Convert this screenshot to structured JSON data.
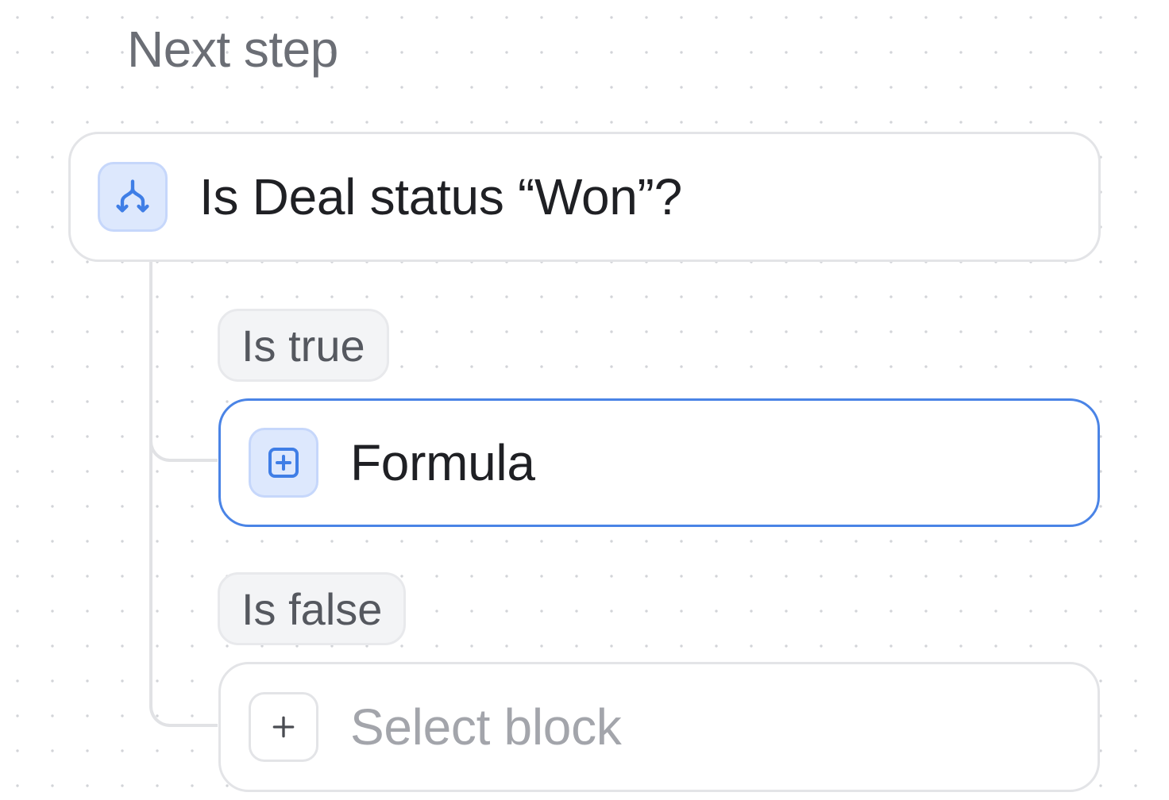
{
  "section_title": "Next step",
  "condition_block": {
    "icon": "branch-icon",
    "label": "Is Deal status “Won”?"
  },
  "branches": [
    {
      "pill_label": "Is true",
      "block": {
        "icon": "formula-icon",
        "label": "Formula",
        "selected": true
      }
    },
    {
      "pill_label": "Is false",
      "block": {
        "icon": "plus-icon",
        "label": "Select block",
        "placeholder": true
      }
    }
  ],
  "colors": {
    "accent": "#4a84e6",
    "icon_bg": "#dde8fd",
    "border": "#e3e4e7",
    "pill_bg": "#f3f4f6"
  }
}
